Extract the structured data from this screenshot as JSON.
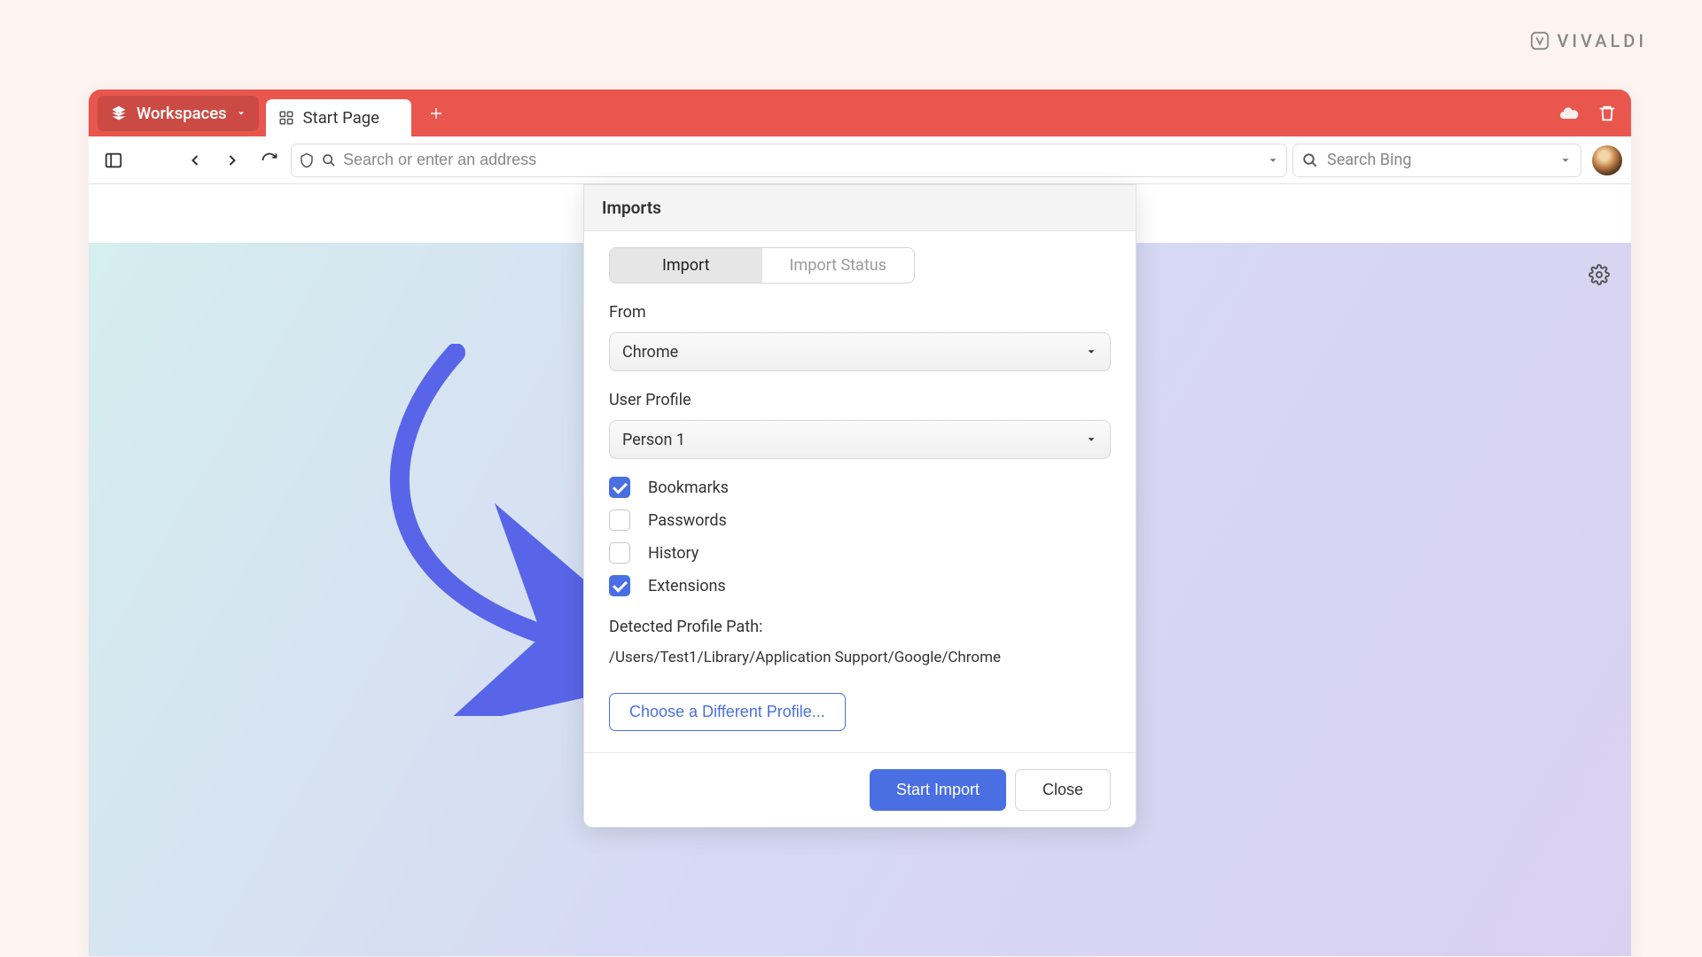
{
  "brand": "VIVALDI",
  "tabbar": {
    "workspaces_label": "Workspaces",
    "active_tab_label": "Start Page"
  },
  "addressbar": {
    "placeholder": "Search or enter an address"
  },
  "searchbox": {
    "placeholder": "Search Bing"
  },
  "dialog": {
    "title": "Imports",
    "tab_import": "Import",
    "tab_status": "Import Status",
    "from_label": "From",
    "from_value": "Chrome",
    "profile_label": "User Profile",
    "profile_value": "Person 1",
    "checkboxes": {
      "bookmarks": {
        "label": "Bookmarks",
        "checked": true
      },
      "passwords": {
        "label": "Passwords",
        "checked": false
      },
      "history": {
        "label": "History",
        "checked": false
      },
      "extensions": {
        "label": "Extensions",
        "checked": true
      }
    },
    "path_label": "Detected Profile Path:",
    "path_value": "/Users/Test1/Library/Application Support/Google/Chrome",
    "choose_profile_btn": "Choose a Different Profile...",
    "start_btn": "Start Import",
    "close_btn": "Close"
  },
  "colors": {
    "accent_red": "#e8564e",
    "accent_blue": "#4a6fe3"
  }
}
